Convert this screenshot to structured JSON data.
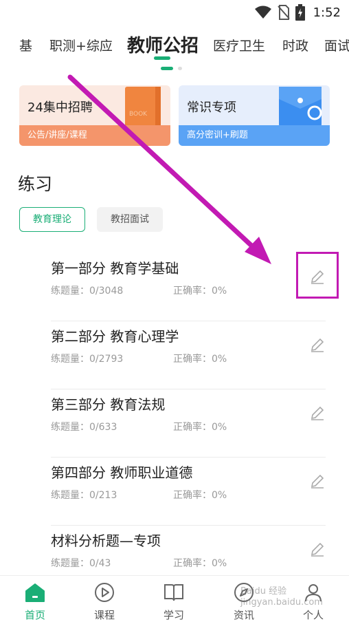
{
  "status_bar": {
    "time": "1:52"
  },
  "tabs": [
    {
      "label": "基",
      "active": false
    },
    {
      "label": "职测+综应",
      "active": false
    },
    {
      "label": "教师公招",
      "active": true
    },
    {
      "label": "医疗卫生",
      "active": false
    },
    {
      "label": "时政",
      "active": false
    },
    {
      "label": "面试",
      "active": false
    }
  ],
  "banners": [
    {
      "title": "24集中招聘",
      "subtitle": "公告/讲座/课程",
      "color": "#f4956b"
    },
    {
      "title": "常识专项",
      "subtitle": "高分密训+刷题",
      "color": "#5aa3f5"
    }
  ],
  "practice": {
    "title": "练习",
    "chips": [
      {
        "label": "教育理论",
        "active": true
      },
      {
        "label": "教招面试",
        "active": false
      }
    ],
    "items": [
      {
        "title": "第一部分  教育学基础",
        "count": "练题量：0/3048",
        "accuracy": "正确率：0%"
      },
      {
        "title": "第二部分  教育心理学",
        "count": "练题量：0/2793",
        "accuracy": "正确率：0%"
      },
      {
        "title": "第三部分  教育法规",
        "count": "练题量：0/633",
        "accuracy": "正确率：0%"
      },
      {
        "title": "第四部分  教师职业道德",
        "count": "练题量：0/213",
        "accuracy": "正确率：0%"
      },
      {
        "title": "材料分析题—专项",
        "count": "练题量：0/43",
        "accuracy": "正确率：0%"
      }
    ]
  },
  "bottom_nav": [
    {
      "label": "首页",
      "icon": "home-icon",
      "active": true
    },
    {
      "label": "课程",
      "icon": "play-circle-icon",
      "active": false
    },
    {
      "label": "学习",
      "icon": "book-icon",
      "active": false
    },
    {
      "label": "资讯",
      "icon": "compass-icon",
      "active": false
    },
    {
      "label": "个人",
      "icon": "person-icon",
      "active": false
    }
  ],
  "watermark": {
    "line1": "Baidu 经验",
    "line2": "jingyan.baidu.com"
  },
  "colors": {
    "accent": "#1aae76",
    "highlight": "#c21ab3"
  }
}
